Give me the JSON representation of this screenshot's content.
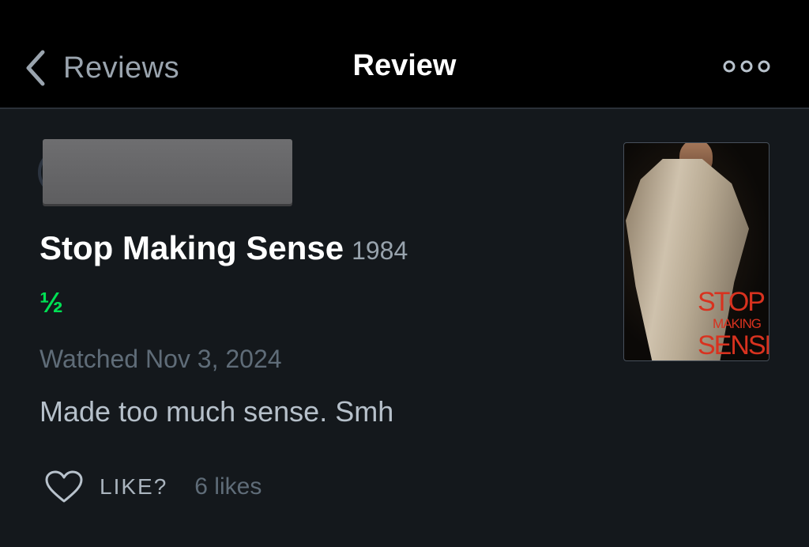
{
  "nav": {
    "back_label": "Reviews",
    "title": "Review",
    "more_icon": "more-horizontal-icon",
    "back_icon": "chevron-left-icon"
  },
  "review": {
    "film_title": "Stop Making Sense",
    "film_year": "1984",
    "rating": "½",
    "watched": "Watched Nov 3, 2024",
    "text": "Made too much sense. Smh",
    "like_label": "LIKE?",
    "likes_count": "6 likes",
    "like_icon": "heart-outline-icon"
  },
  "poster": {
    "line1": "STOP",
    "line2": "MAKING",
    "line3": "SENSE"
  },
  "colors": {
    "background": "#14181c",
    "nav_background": "#000000",
    "rating_green": "#00e054",
    "poster_text_red": "#d8321f"
  }
}
